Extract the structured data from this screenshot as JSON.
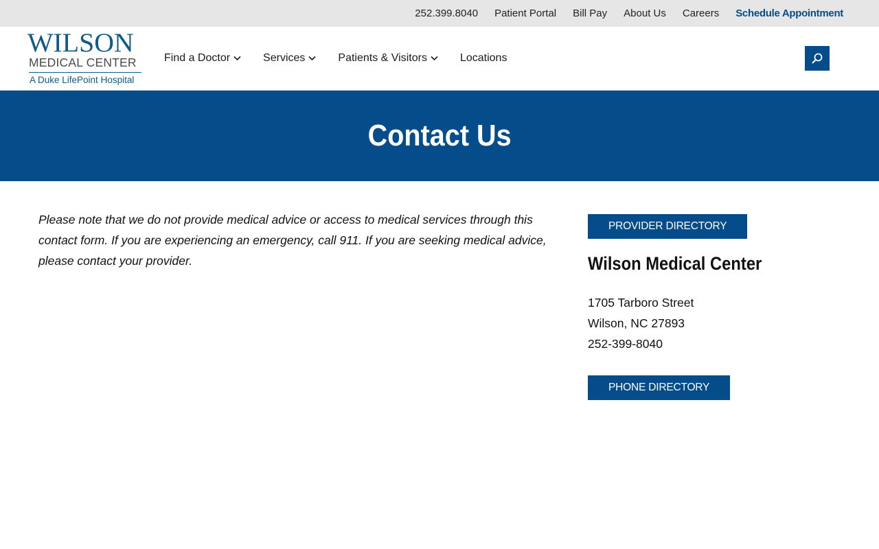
{
  "utility": {
    "phone": "252.399.8040",
    "patient_portal": "Patient Portal",
    "bill_pay": "Bill Pay",
    "about_us": "About Us",
    "careers": "Careers",
    "schedule": "Schedule Appointment"
  },
  "logo": {
    "wordmark": "WILSON",
    "subtitle": "MEDICAL CENTER",
    "tagline": "A Duke LifePoint Hospital"
  },
  "nav": {
    "find_doctor": "Find a Doctor",
    "services": "Services",
    "patients_visitors": "Patients & Visitors",
    "locations": "Locations"
  },
  "hero": {
    "title": "Contact Us"
  },
  "notice": "Please note that we do not provide medical advice or access to medical services through this contact form. If you are experiencing an emergency, call 911. If you are seeking medical advice, please contact your provider.",
  "sidebar": {
    "provider_directory": "PROVIDER DIRECTORY",
    "org_name": "Wilson Medical Center",
    "street": "1705 Tarboro Street",
    "city_state_zip": "Wilson, NC 27893",
    "phone": "252-399-8040",
    "phone_directory": "PHONE DIRECTORY"
  },
  "icons": {
    "search": "search-icon",
    "chevron": "chevron-down-icon"
  },
  "colors": {
    "brand_blue": "#054d8a",
    "utility_bg": "#e6e6e6",
    "logo_blue": "#0e5a8a"
  }
}
